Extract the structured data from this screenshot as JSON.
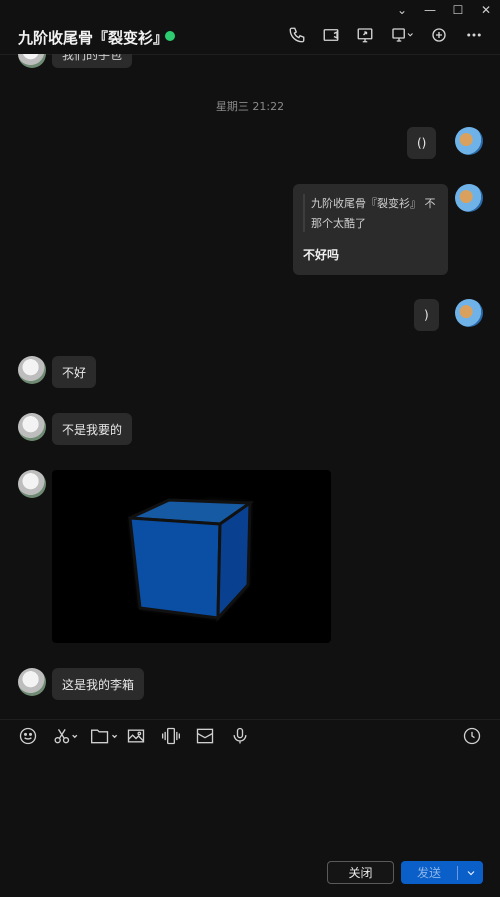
{
  "window": {
    "controls": [
      "chevron-down-icon",
      "minimize-icon",
      "maximize-icon",
      "close-icon"
    ]
  },
  "header": {
    "title": "九阶收尾骨『裂变衫』",
    "status_color": "#2ecc71",
    "icons": [
      "phone-icon",
      "video-icon",
      "screen-share-icon",
      "remote-desktop-icon",
      "add-member-icon",
      "more-icon"
    ]
  },
  "chat": {
    "top_partial": "我们的手包",
    "timestamp": "星期三 21:22",
    "messages": [
      {
        "side": "right",
        "text": "()"
      },
      {
        "side": "right",
        "quote": "九阶收尾骨『裂变衫』 不那个太酷了",
        "reply": "不好吗"
      },
      {
        "side": "right",
        "text": ")"
      },
      {
        "side": "left",
        "text": "不好"
      },
      {
        "side": "left",
        "text": "不是我要的"
      },
      {
        "side": "left",
        "image": "blue-cube"
      },
      {
        "side": "left",
        "text": "这是我的李箱"
      }
    ]
  },
  "toolbar": {
    "icons": [
      "emoji-icon",
      "scissors-icon",
      "folder-icon",
      "screenshot-icon",
      "shake-icon",
      "envelope-icon",
      "microphone-icon",
      "history-clock-icon"
    ]
  },
  "actions": {
    "close_label": "关闭",
    "send_label": "发送"
  },
  "colors": {
    "accent": "#0a5fc8",
    "background": "#111111",
    "bubble": "#2b2b2b"
  }
}
